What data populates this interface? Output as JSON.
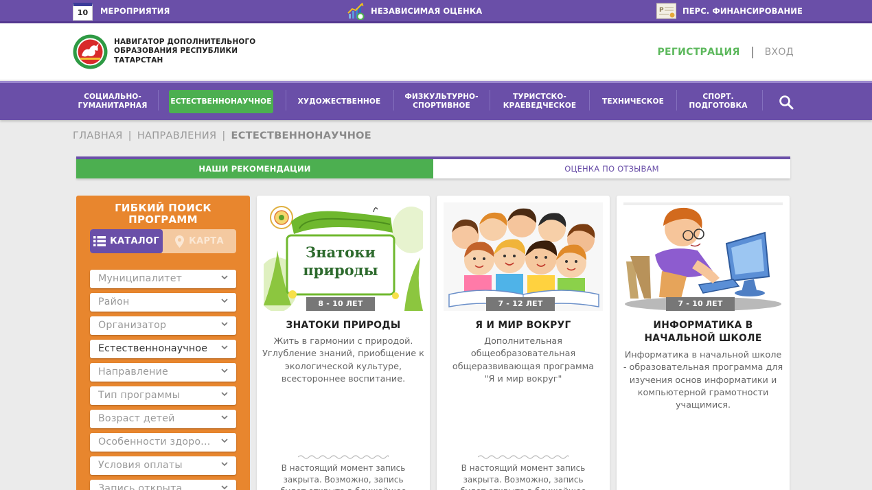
{
  "topbar": {
    "events": {
      "label": "МЕРОПРИЯТИЯ",
      "calendar_day": "10",
      "icon": "calendar-icon"
    },
    "rating": {
      "label": "НЕЗАВИСИМАЯ ОЦЕНКА",
      "icon": "chart-icon"
    },
    "funding": {
      "label": "ПЕРС. ФИНАНСИРОВАНИЕ",
      "icon": "certificate-icon"
    }
  },
  "header": {
    "title_lines": [
      "НАВИГАТОР ДОПОЛНИТЕЛЬНОГО",
      "ОБРАЗОВАНИЯ РЕСПУБЛИКИ",
      "ТАТАРСТАН"
    ],
    "register": "РЕГИСТРАЦИЯ",
    "login": "ВХОД"
  },
  "nav": {
    "items": [
      {
        "line1": "СОЦИАЛЬНО-",
        "line2": "ГУМАНИТАРНАЯ",
        "active": false
      },
      {
        "line1": "ЕСТЕСТВЕННОНАУЧНОЕ",
        "line2": "",
        "active": true
      },
      {
        "line1": "ХУДОЖЕСТВЕННОЕ",
        "line2": "",
        "active": false
      },
      {
        "line1": "ФИЗКУЛЬТУРНО-",
        "line2": "СПОРТИВНОЕ",
        "active": false
      },
      {
        "line1": "ТУРИСТСКО-",
        "line2": "КРАЕВЕДЧЕСКОЕ",
        "active": false
      },
      {
        "line1": "ТЕХНИЧЕСКОЕ",
        "line2": "",
        "active": false
      },
      {
        "line1": "СПОРТ.",
        "line2": "ПОДГОТОВКА",
        "active": false
      }
    ],
    "search_icon": "search-icon"
  },
  "breadcrumb": [
    "ГЛАВНАЯ",
    "НАПРАВЛЕНИЯ",
    "ЕСТЕСТВЕННОНАУЧНОЕ"
  ],
  "tabs": {
    "active": "НАШИ РЕКОМЕНДАЦИИ",
    "inactive": "ОЦЕНКА ПО ОТЗЫВАМ"
  },
  "filter": {
    "title_line1": "ГИБКИЙ ПОИСК",
    "title_line2": "ПРОГРАММ",
    "catalog": "КАТАЛОГ",
    "map": "КАРТА",
    "selects": [
      {
        "label": "Муниципалитет",
        "selected": false
      },
      {
        "label": "Район",
        "selected": false
      },
      {
        "label": "Организатор",
        "selected": false
      },
      {
        "label": "Естественнонаучное",
        "selected": true
      },
      {
        "label": "Направление",
        "selected": false
      },
      {
        "label": "Тип программы",
        "selected": false
      },
      {
        "label": "Возраст детей",
        "selected": false
      },
      {
        "label": "Особенности здоро...",
        "selected": false
      },
      {
        "label": "Условия оплаты",
        "selected": false
      },
      {
        "label": "Запись открыта",
        "selected": false
      }
    ]
  },
  "cards": [
    {
      "age": "8 - 10 ЛЕТ",
      "title": "ЗНАТОКИ ПРИРОДЫ",
      "image_text_line1": "Знатоки",
      "image_text_line2": "природы",
      "description": "Жить в гармонии с природой. Углубление знаний, приобщение к экологической культуре, всестороннее воспитание.",
      "note": "В настоящий момент запись закрыта. Возможно, запись будет открыта в ближайшее время."
    },
    {
      "age": "7 - 12 ЛЕТ",
      "title": "Я И МИР ВОКРУГ",
      "description": "Дополнительная общеобразовательная общеразвивающая программа \"Я и мир вокруг\"",
      "note": "В настоящий момент запись закрыта. Возможно, запись будет открыта в ближайшее время."
    },
    {
      "age": "7 - 10 ЛЕТ",
      "title_line1": "ИНФОРМАТИКА В",
      "title_line2": "НАЧАЛЬНОЙ ШКОЛЕ",
      "description": "Информатика в начальной школе - образовательная программа для изучения основ информатики и компьютерной грамотности учащимися."
    }
  ],
  "colors": {
    "purple": "#6a4fa8",
    "green": "#4caf50",
    "orange": "#e8862e",
    "register_green": "#5cb85c"
  }
}
